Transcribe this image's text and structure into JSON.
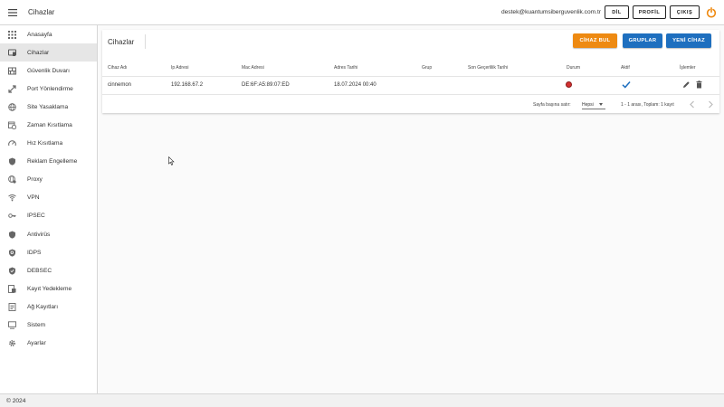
{
  "header": {
    "title": "Cihazlar",
    "email": "destek@kuantumsiberguvenlik.com.tr",
    "buttons": {
      "lang": "DİL",
      "profile": "PROFİL",
      "logout": "ÇIKIŞ"
    },
    "icons": {
      "menu": "hamburger-menu-icon",
      "power": "power-icon"
    },
    "accent": "#ee8a12"
  },
  "sidebar": {
    "items": [
      {
        "label": "Anasayfa",
        "icon": "grid-icon"
      },
      {
        "label": "Cihazlar",
        "icon": "devices-icon",
        "active": true
      },
      {
        "label": "Güvenlik Duvarı",
        "icon": "firewall-icon"
      },
      {
        "label": "Port Yönlendirme",
        "icon": "port-forward-icon"
      },
      {
        "label": "Site Yasaklama",
        "icon": "globe-icon"
      },
      {
        "label": "Zaman Kısıtlama",
        "icon": "calendar-clock-icon"
      },
      {
        "label": "Hız Kısıtlama",
        "icon": "speedometer-icon"
      },
      {
        "label": "Reklam Engelleme",
        "icon": "shield-icon"
      },
      {
        "label": "Proxy",
        "icon": "proxy-globe-icon"
      },
      {
        "label": "VPN",
        "icon": "vpn-icon"
      },
      {
        "label": "IPSEC",
        "icon": "key-icon"
      },
      {
        "label": "Antivirüs",
        "icon": "shield-icon"
      },
      {
        "label": "IDPS",
        "icon": "shield-search-icon"
      },
      {
        "label": "DEBSEC",
        "icon": "shield-check-icon"
      },
      {
        "label": "Kayıt Yedekleme",
        "icon": "backup-icon"
      },
      {
        "label": "Ağ Kayıtları",
        "icon": "logs-icon"
      },
      {
        "label": "Sistem",
        "icon": "monitor-icon"
      },
      {
        "label": "Ayarlar",
        "icon": "gear-icon"
      }
    ]
  },
  "main": {
    "title": "Cihazlar",
    "buttons": {
      "find": "CİHAZ BUL",
      "groups": "GRUPLAR",
      "new": "YENİ CİHAZ"
    },
    "table": {
      "headers": [
        "Cihaz Adı",
        "Ip Adresi",
        "Mac Adresi",
        "Adres Tarihi",
        "Grup",
        "Son Geçerlilik Tarihi",
        "Durum",
        "Aktif",
        "İşlemler"
      ],
      "rows": [
        {
          "name": "cinnemon",
          "ip": "192.168.67.2",
          "mac": "DE:6F:A5:89:07:ED",
          "date": "18.07.2024 00:40",
          "group": "",
          "expiry": "",
          "status": "offline",
          "status_color": "#d32f2f",
          "active": true,
          "active_color": "#1e6fbf"
        }
      ]
    },
    "pagination": {
      "rows_per_page_label": "Sayfa başına satır:",
      "rows_per_page_value": "Hepsi",
      "range": "1 - 1 arası, Toplam: 1 kayıt"
    }
  },
  "footer": {
    "text": "© 2024"
  }
}
